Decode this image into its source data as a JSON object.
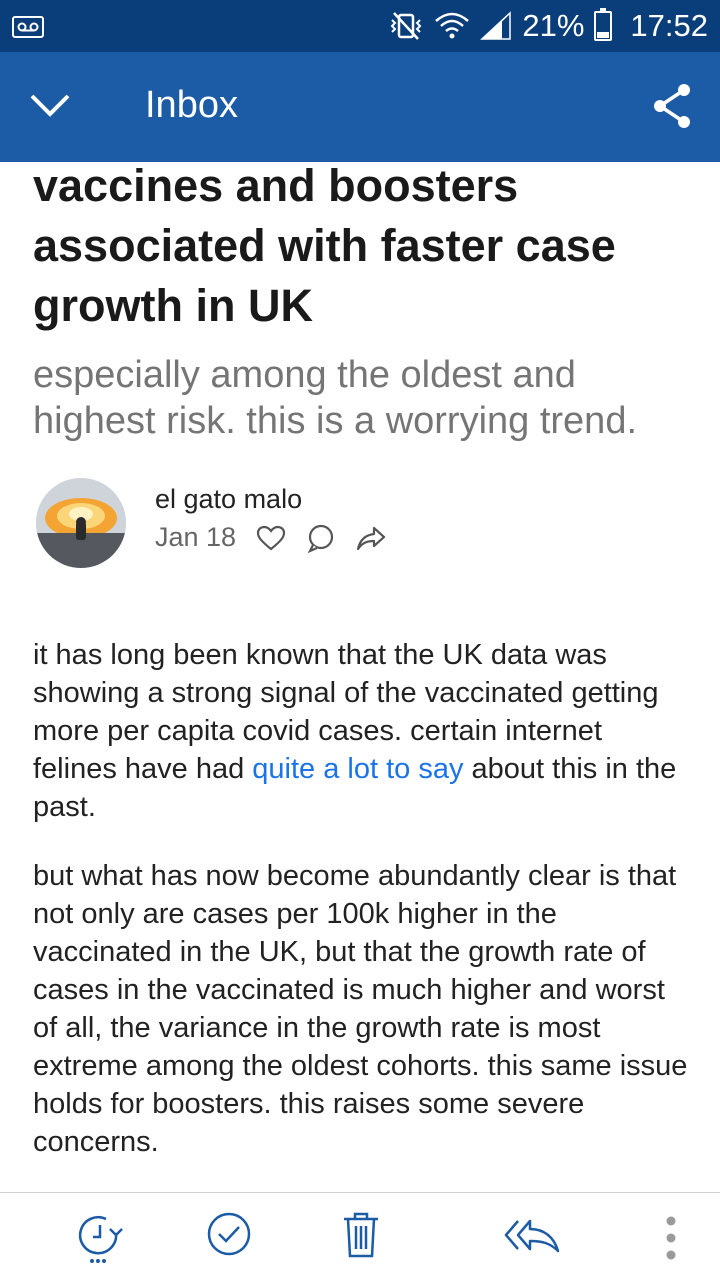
{
  "status_bar": {
    "battery_percent": "21%",
    "time": "17:52",
    "icons": [
      "voicemail-icon",
      "vibrate-icon",
      "wifi-icon",
      "signal-icon",
      "battery-icon"
    ]
  },
  "app_bar": {
    "title": "Inbox",
    "icons": [
      "chevron-down-icon",
      "share-icon"
    ]
  },
  "article": {
    "headline": "vaccines and boosters associated with faster case growth in UK",
    "subtitle": "especially among the oldest and highest risk. this is a worrying trend.",
    "author": "el gato malo",
    "date": "Jan 18",
    "paragraph1": {
      "before_link": "it has long been known that the UK data was showing a strong signal of the vaccinated getting more per capita covid cases. certain internet felines have had ",
      "link_text": "quite a lot to say",
      "after_link": " about this in the past."
    },
    "paragraph2": "but what has now become abundantly clear is that not only are cases per 100k higher in the vaccinated in the UK, but that the growth rate of cases in the vaccinated is much higher and worst of all, the variance in the growth rate is most extreme among the oldest cohorts. this same issue holds for boosters. this raises some severe concerns."
  },
  "toolbar": {
    "icons": [
      "snooze-icon",
      "mark-done-icon",
      "trash-icon",
      "reply-all-icon",
      "more-vert-icon"
    ]
  },
  "colors": {
    "status_bar": "#0a3e7a",
    "app_bar": "#1c5ba5",
    "accent_blue": "#1c5ba5",
    "link": "#1a73e8"
  }
}
